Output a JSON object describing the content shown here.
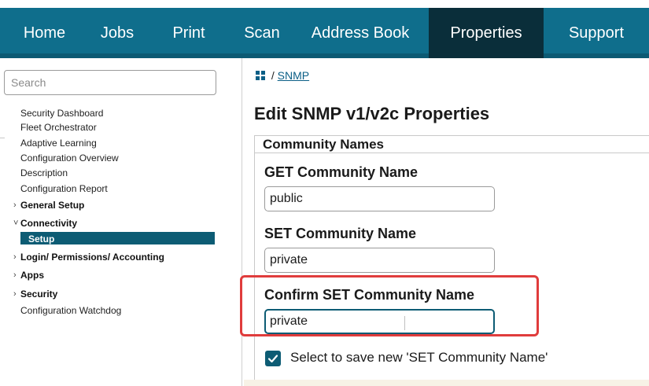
{
  "nav": {
    "tabs": [
      {
        "label": "Home",
        "active": false
      },
      {
        "label": "Jobs",
        "active": false
      },
      {
        "label": "Print",
        "active": false
      },
      {
        "label": "Scan",
        "active": false
      },
      {
        "label": "Address Book",
        "active": false
      },
      {
        "label": "Properties",
        "active": true
      },
      {
        "label": "Support",
        "active": false
      }
    ],
    "bar_color": "#0f6e8c",
    "active_color": "#0a2e3a"
  },
  "sidebar": {
    "search_placeholder": "Search",
    "items": [
      {
        "label": "Security Dashboard"
      },
      {
        "label": "Fleet Orchestrator"
      },
      {
        "label": "Adaptive Learning"
      },
      {
        "label": "Configuration Overview"
      },
      {
        "label": "Description"
      },
      {
        "label": "Configuration Report"
      },
      {
        "label": "General Setup",
        "group": true,
        "expanded": false
      },
      {
        "label": "Connectivity",
        "group": true,
        "expanded": true
      },
      {
        "label": "Setup",
        "selected": true
      },
      {
        "label": "Login/ Permissions/ Accounting",
        "group": true,
        "expanded": false
      },
      {
        "label": "Apps",
        "group": true,
        "expanded": false
      },
      {
        "label": "Security",
        "group": true,
        "expanded": false
      },
      {
        "label": "Configuration Watchdog"
      }
    ],
    "selected_color": "#0d5c74"
  },
  "breadcrumb": {
    "separator": "/",
    "link": "SNMP"
  },
  "page_title": "Edit SNMP v1/v2c Properties",
  "panel": {
    "header": "Community Names",
    "get_label": "GET Community Name",
    "get_value": "public",
    "set_label": "SET Community Name",
    "set_value": "private",
    "confirm_label": "Confirm SET Community Name",
    "confirm_value": "private",
    "save_checkbox_label": "Select to save new 'SET Community Name'",
    "save_checked": true
  },
  "highlight_color": "#e03c3c"
}
